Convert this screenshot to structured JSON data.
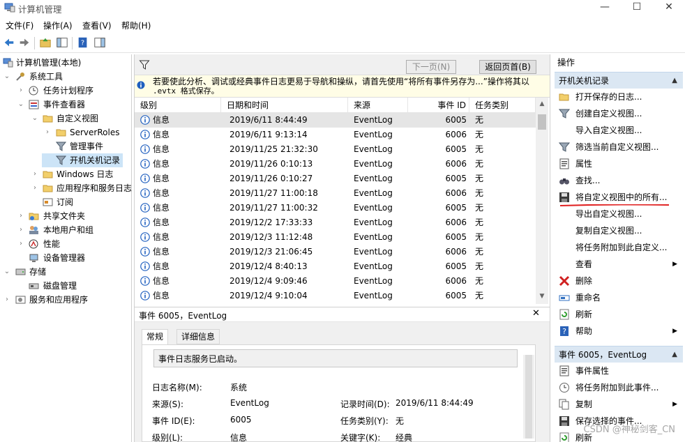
{
  "window": {
    "title": "计算机管理",
    "buttons": {
      "minimize": "—",
      "maximize": "☐",
      "close": "✕"
    }
  },
  "menu": [
    "文件(F)",
    "操作(A)",
    "查看(V)",
    "帮助(H)"
  ],
  "tree": [
    {
      "label": "计算机管理(本地)",
      "icon": "computer-icon"
    },
    {
      "label": "系统工具",
      "icon": "tools-icon"
    },
    {
      "label": "任务计划程序",
      "icon": "clock-icon"
    },
    {
      "label": "事件查看器",
      "icon": "event-viewer-icon"
    },
    {
      "label": "自定义视图",
      "icon": "folder-icon"
    },
    {
      "label": "ServerRoles",
      "icon": "folder-icon"
    },
    {
      "label": "管理事件",
      "icon": "filter-icon"
    },
    {
      "label": "开机关机记录",
      "icon": "filter-icon"
    },
    {
      "label": "Windows 日志",
      "icon": "folder-icon"
    },
    {
      "label": "应用程序和服务日志",
      "icon": "folder-icon"
    },
    {
      "label": "订阅",
      "icon": "subscription-icon"
    },
    {
      "label": "共享文件夹",
      "icon": "shared-folder-icon"
    },
    {
      "label": "本地用户和组",
      "icon": "users-icon"
    },
    {
      "label": "性能",
      "icon": "performance-icon"
    },
    {
      "label": "设备管理器",
      "icon": "device-manager-icon"
    },
    {
      "label": "存储",
      "icon": "storage-icon"
    },
    {
      "label": "磁盘管理",
      "icon": "disk-icon"
    },
    {
      "label": "服务和应用程序",
      "icon": "services-icon"
    }
  ],
  "center": {
    "prev_page": "下一页(N)",
    "home_page": "返回页首(B)",
    "info_line1": "若要使此分析、调试或经典事件日志更易于导航和操纵，请首先使用“将所有事件另存为...”操作将其以",
    "info_line2": ".evtx 格式保存。",
    "columns": [
      "级别",
      "日期和时间",
      "来源",
      "事件 ID",
      "任务类别"
    ],
    "rows": [
      [
        "信息",
        "2019/6/11 8:44:49",
        "EventLog",
        "6005",
        "无"
      ],
      [
        "信息",
        "2019/6/11 9:13:14",
        "EventLog",
        "6006",
        "无"
      ],
      [
        "信息",
        "2019/11/25 21:32:30",
        "EventLog",
        "6005",
        "无"
      ],
      [
        "信息",
        "2019/11/26 0:10:13",
        "EventLog",
        "6006",
        "无"
      ],
      [
        "信息",
        "2019/11/26 0:10:27",
        "EventLog",
        "6005",
        "无"
      ],
      [
        "信息",
        "2019/11/27 11:00:18",
        "EventLog",
        "6006",
        "无"
      ],
      [
        "信息",
        "2019/11/27 11:00:32",
        "EventLog",
        "6005",
        "无"
      ],
      [
        "信息",
        "2019/12/2 17:33:33",
        "EventLog",
        "6006",
        "无"
      ],
      [
        "信息",
        "2019/12/3 11:12:48",
        "EventLog",
        "6005",
        "无"
      ],
      [
        "信息",
        "2019/12/3 21:06:45",
        "EventLog",
        "6006",
        "无"
      ],
      [
        "信息",
        "2019/12/4 8:40:13",
        "EventLog",
        "6005",
        "无"
      ],
      [
        "信息",
        "2019/12/4 9:09:46",
        "EventLog",
        "6006",
        "无"
      ],
      [
        "信息",
        "2019/12/4 9:10:04",
        "EventLog",
        "6005",
        "无"
      ]
    ],
    "detail_title": "事件 6005，EventLog",
    "tabs": [
      "常规",
      "详细信息"
    ],
    "message": "事件日志服务已启动。",
    "fields": {
      "log_name_label": "日志名称(M):",
      "log_name": "系统",
      "source_label": "来源(S):",
      "source": "EventLog",
      "logged_label": "记录时间(D):",
      "logged": "2019/6/11 8:44:49",
      "event_id_label": "事件 ID(E):",
      "event_id": "6005",
      "task_label": "任务类别(Y):",
      "task": "无",
      "level_label": "级别(L):",
      "level": "信息",
      "keywords_label": "关键字(K):",
      "keywords": "经典"
    }
  },
  "actions": {
    "header": "操作",
    "section1": "开机关机记录",
    "items1": [
      {
        "label": "打开保存的日志...",
        "icon": "open-folder-icon"
      },
      {
        "label": "创建自定义视图...",
        "icon": "filter-icon"
      },
      {
        "label": "导入自定义视图...",
        "icon": ""
      },
      {
        "label": "筛选当前自定义视图...",
        "icon": "filter-icon"
      },
      {
        "label": "属性",
        "icon": "properties-icon"
      },
      {
        "label": "查找...",
        "icon": "binoculars-icon"
      },
      {
        "label": "将自定义视图中的所有...",
        "icon": "save-icon"
      },
      {
        "label": "导出自定义视图...",
        "icon": ""
      },
      {
        "label": "复制自定义视图...",
        "icon": ""
      },
      {
        "label": "将任务附加到此自定义...",
        "icon": ""
      },
      {
        "label": "查看",
        "icon": "",
        "submenu": true
      },
      {
        "label": "删除",
        "icon": "delete-icon"
      },
      {
        "label": "重命名",
        "icon": "rename-icon"
      },
      {
        "label": "刷新",
        "icon": "refresh-icon"
      },
      {
        "label": "帮助",
        "icon": "help-icon",
        "submenu": true
      }
    ],
    "section2": "事件 6005，EventLog",
    "items2": [
      {
        "label": "事件属性",
        "icon": "properties-icon"
      },
      {
        "label": "将任务附加到此事件...",
        "icon": "task-icon"
      },
      {
        "label": "复制",
        "icon": "copy-icon",
        "submenu": true
      },
      {
        "label": "保存选择的事件...",
        "icon": "save-icon"
      },
      {
        "label": "刷新",
        "icon": "refresh-icon"
      }
    ]
  },
  "watermark": "CSDN @神秘剑客_CN",
  "colors": {
    "accent": "#0078d7",
    "selection": "#cce4f7",
    "section": "#dbe7f3",
    "annotation": "#e02020"
  }
}
